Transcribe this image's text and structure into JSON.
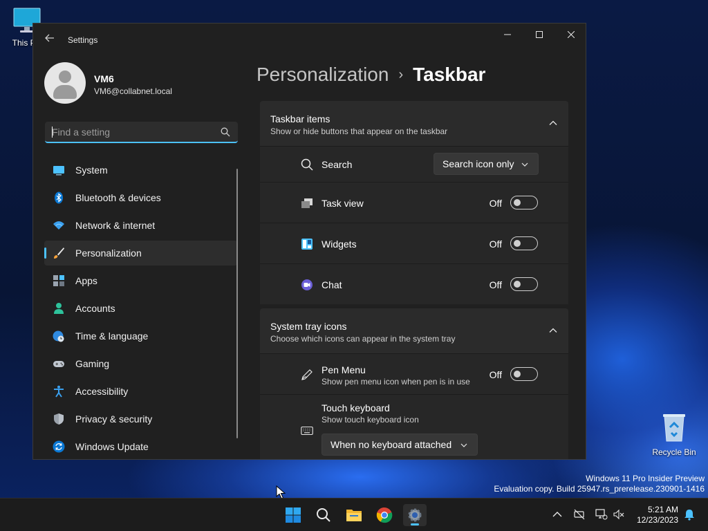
{
  "desktop": {
    "icons": [
      {
        "label": "This PC",
        "icon": "monitor-icon"
      },
      {
        "label": "Recycle Bin",
        "icon": "recycle-bin-icon"
      }
    ],
    "watermark_line1": "Windows 11 Pro Insider Preview",
    "watermark_line2": "Evaluation copy. Build 25947.rs_prerelease.230901-1416"
  },
  "window": {
    "title": "Settings",
    "controls": {
      "minimize": "minimize-icon",
      "maximize": "maximize-icon",
      "close": "close-icon"
    }
  },
  "profile": {
    "name": "VM6",
    "email": "VM6@collabnet.local"
  },
  "search": {
    "placeholder": "Find a setting",
    "value": ""
  },
  "sidebar": {
    "items": [
      {
        "label": "System",
        "icon": "system-monitor-icon",
        "active": false
      },
      {
        "label": "Bluetooth & devices",
        "icon": "bluetooth-icon",
        "active": false
      },
      {
        "label": "Network & internet",
        "icon": "wifi-icon",
        "active": false
      },
      {
        "label": "Personalization",
        "icon": "paintbrush-icon",
        "active": true
      },
      {
        "label": "Apps",
        "icon": "apps-icon",
        "active": false
      },
      {
        "label": "Accounts",
        "icon": "person-icon",
        "active": false
      },
      {
        "label": "Time & language",
        "icon": "globe-clock-icon",
        "active": false
      },
      {
        "label": "Gaming",
        "icon": "gamepad-icon",
        "active": false
      },
      {
        "label": "Accessibility",
        "icon": "accessibility-icon",
        "active": false
      },
      {
        "label": "Privacy & security",
        "icon": "shield-icon",
        "active": false
      },
      {
        "label": "Windows Update",
        "icon": "update-icon",
        "active": false
      }
    ]
  },
  "breadcrumb": {
    "parent": "Personalization",
    "separator": "›",
    "current": "Taskbar"
  },
  "taskbar_items": {
    "title": "Taskbar items",
    "subtitle": "Show or hide buttons that appear on the taskbar",
    "rows": [
      {
        "label": "Search",
        "icon": "search-icon",
        "dropdown_value": "Search icon only"
      },
      {
        "label": "Task view",
        "icon": "task-view-icon",
        "state": "Off"
      },
      {
        "label": "Widgets",
        "icon": "widgets-icon",
        "state": "Off"
      },
      {
        "label": "Chat",
        "icon": "chat-icon",
        "state": "Off"
      }
    ]
  },
  "system_tray": {
    "title": "System tray icons",
    "subtitle": "Choose which icons can appear in the system tray",
    "pen_menu": {
      "label": "Pen Menu",
      "subtitle": "Show pen menu icon when pen is in use",
      "state": "Off",
      "icon": "pen-icon"
    },
    "touch_keyboard": {
      "label": "Touch keyboard",
      "subtitle": "Show touch keyboard icon",
      "dropdown_value": "When no keyboard attached",
      "icon": "keyboard-icon"
    }
  },
  "taskbar": {
    "apps": [
      {
        "name": "start",
        "icon": "windows-start-icon"
      },
      {
        "name": "search",
        "icon": "search-icon"
      },
      {
        "name": "file-explorer",
        "icon": "folder-icon"
      },
      {
        "name": "chrome",
        "icon": "chrome-icon"
      },
      {
        "name": "settings",
        "icon": "gear-icon",
        "active": true
      }
    ],
    "tray": [
      "chevron-up-icon",
      "network-disconnected-icon",
      "display-icon",
      "volume-muted-icon"
    ],
    "time": "5:21 AM",
    "date": "12/23/2023",
    "notification_icon": "bell-icon"
  },
  "colors": {
    "accent": "#4cc2ff",
    "window_bg": "#202020",
    "card_bg": "#2b2b2b",
    "taskbar_bg": "#1c1c1c"
  }
}
